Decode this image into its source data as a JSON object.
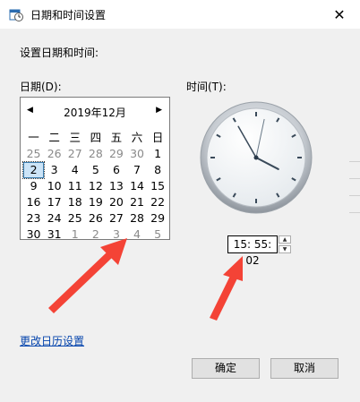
{
  "window": {
    "title": "日期和时间设置",
    "close_glyph": "✕"
  },
  "labels": {
    "section": "设置日期和时间:",
    "date": "日期(D):",
    "time": "时间(T):"
  },
  "calendar": {
    "title": "2019年12月",
    "prev": "◀",
    "next": "▶",
    "weekdays": [
      "一",
      "二",
      "三",
      "四",
      "五",
      "六",
      "日"
    ],
    "weeks": [
      [
        {
          "d": "25",
          "o": true
        },
        {
          "d": "26",
          "o": true
        },
        {
          "d": "27",
          "o": true
        },
        {
          "d": "28",
          "o": true
        },
        {
          "d": "29",
          "o": true
        },
        {
          "d": "30",
          "o": true
        },
        {
          "d": "1",
          "o": false
        }
      ],
      [
        {
          "d": "2",
          "o": false,
          "sel": true
        },
        {
          "d": "3",
          "o": false
        },
        {
          "d": "4",
          "o": false
        },
        {
          "d": "5",
          "o": false
        },
        {
          "d": "6",
          "o": false
        },
        {
          "d": "7",
          "o": false
        },
        {
          "d": "8",
          "o": false
        }
      ],
      [
        {
          "d": "9",
          "o": false
        },
        {
          "d": "10",
          "o": false
        },
        {
          "d": "11",
          "o": false
        },
        {
          "d": "12",
          "o": false
        },
        {
          "d": "13",
          "o": false
        },
        {
          "d": "14",
          "o": false
        },
        {
          "d": "15",
          "o": false
        }
      ],
      [
        {
          "d": "16",
          "o": false
        },
        {
          "d": "17",
          "o": false
        },
        {
          "d": "18",
          "o": false
        },
        {
          "d": "19",
          "o": false
        },
        {
          "d": "20",
          "o": false
        },
        {
          "d": "21",
          "o": false
        },
        {
          "d": "22",
          "o": false
        }
      ],
      [
        {
          "d": "23",
          "o": false
        },
        {
          "d": "24",
          "o": false
        },
        {
          "d": "25",
          "o": false
        },
        {
          "d": "26",
          "o": false
        },
        {
          "d": "27",
          "o": false
        },
        {
          "d": "28",
          "o": false
        },
        {
          "d": "29",
          "o": false
        }
      ],
      [
        {
          "d": "30",
          "o": false
        },
        {
          "d": "31",
          "o": false
        },
        {
          "d": "1",
          "o": true
        },
        {
          "d": "2",
          "o": true
        },
        {
          "d": "3",
          "o": true
        },
        {
          "d": "4",
          "o": true
        },
        {
          "d": "5",
          "o": true
        }
      ]
    ]
  },
  "time": {
    "value": "15: 55: 02",
    "hour": 15,
    "minute": 55,
    "second": 2
  },
  "link": {
    "change_calendar": "更改日历设置"
  },
  "buttons": {
    "ok": "确定",
    "cancel": "取消"
  },
  "colors": {
    "arrow": "#f44336",
    "link": "#0645ad"
  }
}
